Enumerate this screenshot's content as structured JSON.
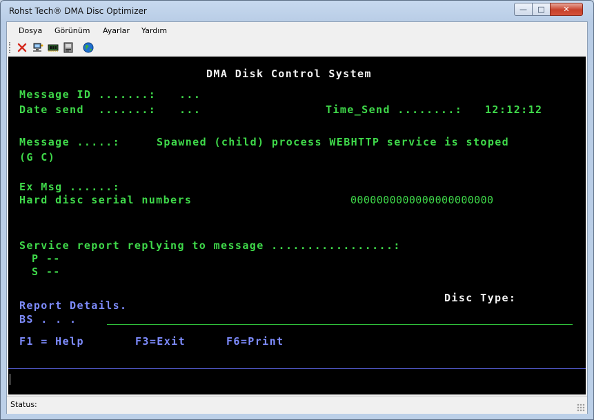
{
  "window": {
    "title": "Rohst Tech® DMA Disc Optimizer",
    "minimize_glyph": "—",
    "maximize_glyph": "□",
    "close_glyph": "✕"
  },
  "menu": [
    {
      "label": "Dosya"
    },
    {
      "label": "Görünüm"
    },
    {
      "label": "Ayarlar"
    },
    {
      "label": "Yardım"
    }
  ],
  "toolbar": {
    "icons": [
      "close-x-icon",
      "network-computer-icon",
      "memory-chip-icon",
      "disk-drive-icon",
      "globe-icon"
    ],
    "accent_colors": {
      "close": "#d42a1e",
      "globe": "#1f6fd0"
    }
  },
  "terminal": {
    "heading": "DMA Disk Control System",
    "message_id_label": "Message ID .......:",
    "message_id_value": "...",
    "date_send_label": "Date send  .......:",
    "date_send_value": "...",
    "time_send_label": "Time_Send ........:",
    "time_send_value": "12:12:12",
    "message_label": "Message .....:",
    "message_text": "Spawned (child) process WEBHTTP service is stoped",
    "message_cont": "(G C)",
    "ex_msg_label": "Ex Msg ......:",
    "serial_label": "Hard disc serial numbers",
    "serial_value": "0000000000000000000000",
    "service_label": "Service report replying to message .................:",
    "p_line": "P --",
    "s_line": "S --",
    "disc_type_label": "Disc Type:",
    "report_details": "Report Details.",
    "bs_label": "BS . . .",
    "f1": "F1 = Help",
    "f3": "F3=Exit",
    "f6": "F6=Print",
    "colors": {
      "green": "#3fd94a",
      "white": "#f2f2f2",
      "blue": "#7e8cff",
      "background": "#000000"
    }
  },
  "status": {
    "label": "Status:"
  }
}
